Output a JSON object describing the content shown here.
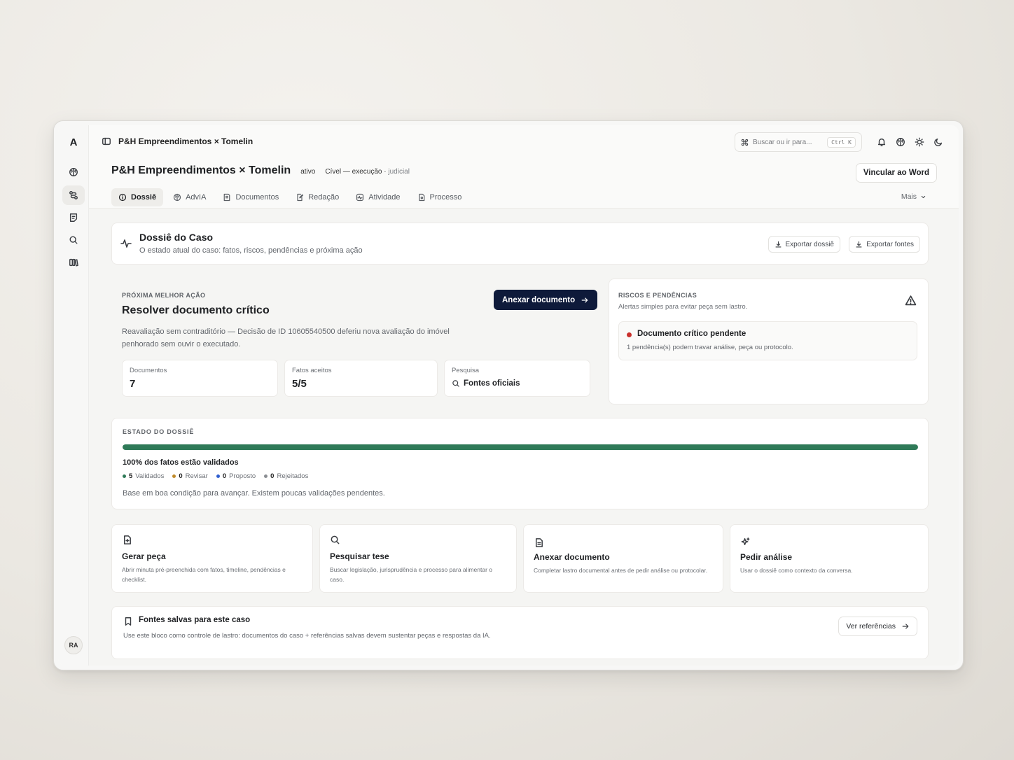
{
  "app": {
    "logo": "A",
    "user_initials": "RA"
  },
  "breadcrumb": {
    "title": "P&H Empreendimentos × Tomelin"
  },
  "search": {
    "placeholder": "Buscar ou ir para...",
    "shortcut": "Ctrl K"
  },
  "case": {
    "title": "P&H Empreendimentos × Tomelin",
    "status": "ativo",
    "area": "Cível — execução",
    "separator": "·",
    "type": "judicial",
    "word_button": "Vincular ao Word"
  },
  "tabs": [
    {
      "label": "Dossiê",
      "icon": "info-icon",
      "active": true
    },
    {
      "label": "AdvIA",
      "icon": "brain-icon",
      "active": false
    },
    {
      "label": "Documentos",
      "icon": "documents-icon",
      "active": false
    },
    {
      "label": "Redação",
      "icon": "edit-file-icon",
      "active": false
    },
    {
      "label": "Atividade",
      "icon": "activity-icon",
      "active": false
    },
    {
      "label": "Processo",
      "icon": "file-icon",
      "active": false
    }
  ],
  "more": {
    "label": "Mais"
  },
  "dossie": {
    "title": "Dossiê do Caso",
    "subtitle": "O estado atual do caso: fatos, riscos, pendências e próxima ação",
    "export_dossie": "Exportar dossiê",
    "export_fontes": "Exportar fontes"
  },
  "next_action": {
    "eyebrow": "PRÓXIMA MELHOR AÇÃO",
    "title": "Resolver documento crítico",
    "description": "Reavaliação sem contraditório — Decisão de ID 10605540500 deferiu nova avaliação do imóvel penhorado sem ouvir o executado.",
    "button": "Anexar documento",
    "stats": [
      {
        "label": "Documentos",
        "value": "7"
      },
      {
        "label": "Fatos aceitos",
        "value": "5/5"
      },
      {
        "label": "Pesquisa",
        "value": "Fontes oficiais"
      }
    ]
  },
  "risks": {
    "eyebrow": "RISCOS E PENDÊNCIAS",
    "subtitle": "Alertas simples para evitar peça sem lastro.",
    "item_title": "Documento crítico pendente",
    "item_desc": "1 pendência(s) podem travar análise, peça ou protocolo.",
    "item_color": "#c9302c"
  },
  "estado": {
    "eyebrow": "ESTADO DO DOSSIÊ",
    "progress": 1.0,
    "progress_color": "#2f7a58",
    "summary": "100% dos fatos estão validados",
    "legend": [
      {
        "count": "5",
        "label": "Validados",
        "color": "#2f7a58"
      },
      {
        "count": "0",
        "label": "Revisar",
        "color": "#c08a2a"
      },
      {
        "count": "0",
        "label": "Proposto",
        "color": "#2f5fd0"
      },
      {
        "count": "0",
        "label": "Rejeitados",
        "color": "#8a8d92"
      }
    ],
    "note": "Base em boa condição para avançar. Existem poucas validações pendentes."
  },
  "actions": [
    {
      "title": "Gerar peça",
      "desc": "Abrir minuta pré-preenchida com fatos, timeline, pendências e checklist.",
      "icon": "file-plus-icon"
    },
    {
      "title": "Pesquisar tese",
      "desc": "Buscar legislação, jurisprudência e processo para alimentar o caso.",
      "icon": "search-icon"
    },
    {
      "title": "Anexar documento",
      "desc": "Completar lastro documental antes de pedir análise ou protocolar.",
      "icon": "document-icon"
    },
    {
      "title": "Pedir análise",
      "desc": "Usar o dossiê como contexto da conversa.",
      "icon": "sparkles-icon"
    }
  ],
  "fontes": {
    "title": "Fontes salvas para este caso",
    "desc": "Use este bloco como controle de lastro: documentos do caso + referências salvas devem sustentar peças e respostas da IA.",
    "button": "Ver referências"
  }
}
